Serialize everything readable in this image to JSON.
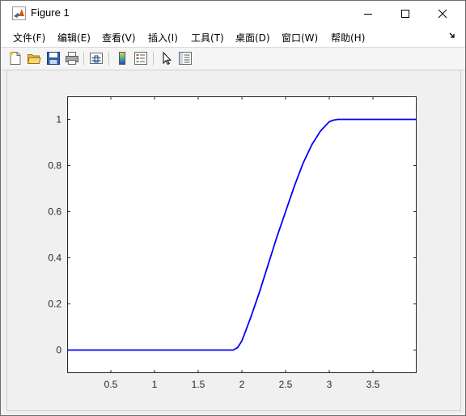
{
  "window": {
    "title": "Figure 1",
    "controls": [
      "minimize",
      "maximize",
      "close"
    ]
  },
  "menu": {
    "items": [
      {
        "label": "文件(F)"
      },
      {
        "label": "编辑(E)"
      },
      {
        "label": "查看(V)"
      },
      {
        "label": "插入(I)"
      },
      {
        "label": "工具(T)"
      },
      {
        "label": "桌面(D)"
      },
      {
        "label": "窗口(W)"
      },
      {
        "label": "帮助(H)"
      }
    ],
    "dock_icon": "dock-arrow-icon"
  },
  "toolbar": {
    "buttons": [
      "new-figure-icon",
      "open-file-icon",
      "save-icon",
      "print-icon",
      "link-plot-icon",
      "colorbar-icon",
      "legend-icon",
      "select-arrow-icon",
      "property-inspector-icon"
    ]
  },
  "chart_data": {
    "type": "line",
    "title": "",
    "xlabel": "",
    "ylabel": "",
    "xlim": [
      0,
      4
    ],
    "ylim": [
      -0.1,
      1.1
    ],
    "xticks": [
      0.5,
      1,
      1.5,
      2,
      2.5,
      3,
      3.5
    ],
    "yticks": [
      0,
      0.2,
      0.4,
      0.6,
      0.8,
      1
    ],
    "xtick_labels": [
      "0.5",
      "1",
      "1.5",
      "2",
      "2.5",
      "3",
      "3.5"
    ],
    "ytick_labels": [
      "0",
      "0.2",
      "0.4",
      "0.6",
      "0.8",
      "1"
    ],
    "grid": false,
    "legend": "none",
    "series": [
      {
        "color": "#0000ff",
        "x": [
          0,
          0.5,
          1,
          1.5,
          1.9,
          1.95,
          2.0,
          2.05,
          2.1,
          2.2,
          2.3,
          2.4,
          2.5,
          2.6,
          2.7,
          2.8,
          2.9,
          3.0,
          3.05,
          3.1,
          3.15,
          3.2,
          3.5,
          4
        ],
        "y": [
          0,
          0,
          0,
          0,
          0.0,
          0.01,
          0.04,
          0.09,
          0.14,
          0.25,
          0.37,
          0.49,
          0.6,
          0.71,
          0.81,
          0.89,
          0.95,
          0.99,
          0.997,
          1.0,
          1.0,
          1.0,
          1.0,
          1.0
        ]
      }
    ]
  }
}
